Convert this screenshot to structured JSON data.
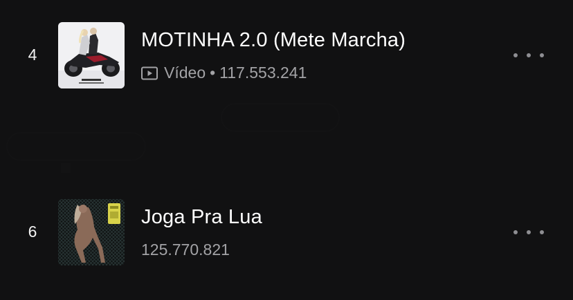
{
  "tracks": [
    {
      "rank": "4",
      "title": "MOTINHA 2.0 (Mete Marcha)",
      "type_label": "Vídeo",
      "separator": "•",
      "plays": "117.553.241",
      "icon": "video-icon"
    },
    {
      "rank": "6",
      "title": "Joga Pra Lua",
      "plays": "125.770.821"
    }
  ],
  "colors": {
    "background": "#111112",
    "primary_text": "#ffffff",
    "secondary_text": "#a3a3a6",
    "more_dots": "#8e8e92"
  },
  "more_icon": "more-horizontal-icon"
}
